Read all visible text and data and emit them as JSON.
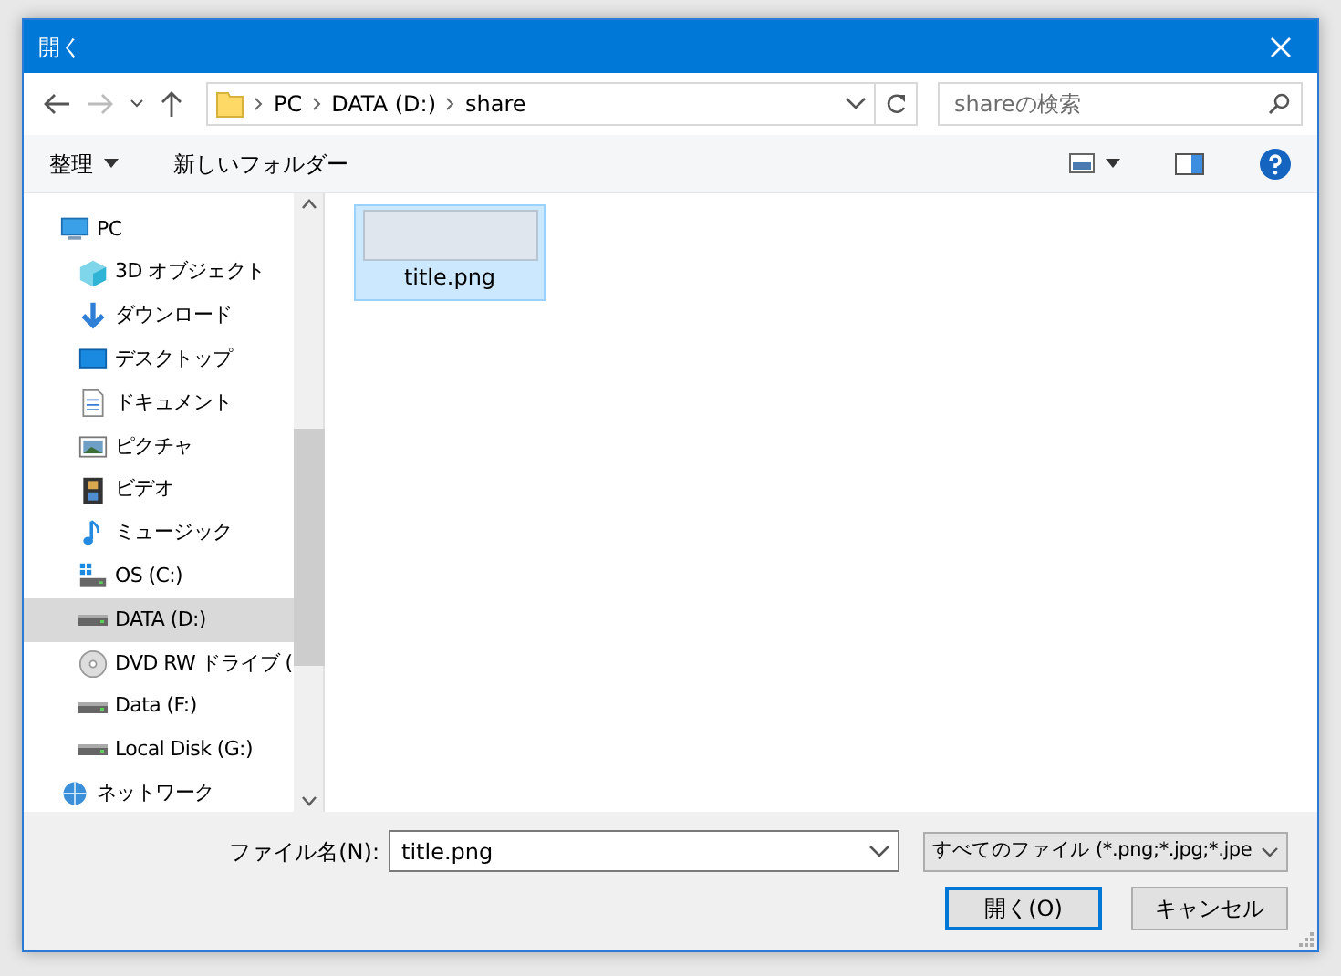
{
  "window": {
    "title": "開く"
  },
  "address_bar": {
    "path": [
      "PC",
      "DATA (D:)",
      "share"
    ]
  },
  "search": {
    "placeholder": "shareの検索"
  },
  "toolbar": {
    "organize": "整理",
    "new_folder": "新しいフォルダー"
  },
  "sidebar": {
    "items": [
      {
        "label": "PC",
        "kind": "pc",
        "selected": false,
        "children": [
          {
            "label": "3D オブジェクト",
            "kind": "cube",
            "selected": false
          },
          {
            "label": "ダウンロード",
            "kind": "download",
            "selected": false
          },
          {
            "label": "デスクトップ",
            "kind": "desktop",
            "selected": false
          },
          {
            "label": "ドキュメント",
            "kind": "document",
            "selected": false
          },
          {
            "label": "ピクチャ",
            "kind": "picture",
            "selected": false
          },
          {
            "label": "ビデオ",
            "kind": "video",
            "selected": false
          },
          {
            "label": "ミュージック",
            "kind": "music",
            "selected": false
          },
          {
            "label": "OS (C:)",
            "kind": "osdrive",
            "selected": false
          },
          {
            "label": "DATA (D:)",
            "kind": "drive",
            "selected": true
          },
          {
            "label": "DVD RW ドライブ (",
            "kind": "dvd",
            "selected": false
          },
          {
            "label": "Data (F:)",
            "kind": "drive",
            "selected": false
          },
          {
            "label": "Local Disk (G:)",
            "kind": "drive",
            "selected": false
          }
        ]
      },
      {
        "label": "ネットワーク",
        "kind": "network",
        "selected": false
      }
    ]
  },
  "files": [
    {
      "name": "title.png",
      "selected": true
    }
  ],
  "footer": {
    "filename_label": "ファイル名(N):",
    "filename_value": "title.png",
    "filter": "すべてのファイル (*.png;*.jpg;*.jpe",
    "open_button": "開く(O)",
    "cancel_button": "キャンセル"
  }
}
